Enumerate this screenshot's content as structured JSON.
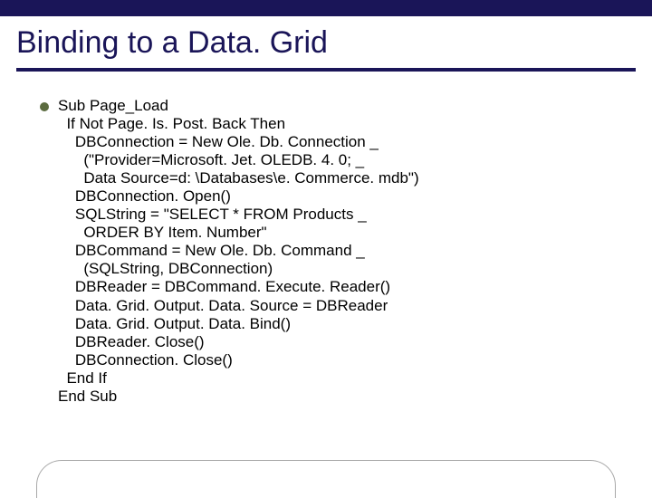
{
  "title": "Binding to a Data. Grid",
  "code_lines": [
    "Sub Page_Load",
    "  If Not Page. Is. Post. Back Then",
    "    DBConnection = New Ole. Db. Connection _",
    "      (\"Provider=Microsoft. Jet. OLEDB. 4. 0; _",
    "      Data Source=d: \\Databases\\e. Commerce. mdb\")",
    "    DBConnection. Open()",
    "    SQLString = \"SELECT * FROM Products _",
    "      ORDER BY Item. Number\"",
    "    DBCommand = New Ole. Db. Command _",
    "      (SQLString, DBConnection)",
    "    DBReader = DBCommand. Execute. Reader()",
    "    Data. Grid. Output. Data. Source = DBReader",
    "    Data. Grid. Output. Data. Bind()",
    "    DBReader. Close()",
    "    DBConnection. Close()",
    "  End If",
    "End Sub"
  ]
}
